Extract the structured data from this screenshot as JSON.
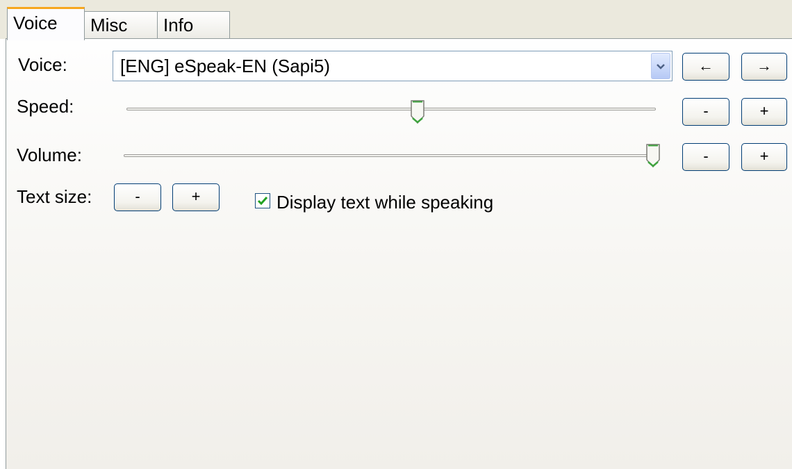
{
  "tabs": [
    {
      "label": "Voice",
      "active": true
    },
    {
      "label": "Misc",
      "active": false
    },
    {
      "label": "Info",
      "active": false
    }
  ],
  "voice": {
    "label": "Voice:",
    "selected": "[ENG] eSpeak-EN (Sapi5)",
    "prev_label": "←",
    "next_label": "→"
  },
  "speed": {
    "label": "Speed:",
    "level_fraction": 0.55,
    "minus": "-",
    "plus": "+"
  },
  "volume": {
    "label": "Volume:",
    "level_fraction": 1.0,
    "minus": "-",
    "plus": "+"
  },
  "text_size": {
    "label": "Text size:",
    "minus": "-",
    "plus": "+"
  },
  "display_text": {
    "label": "Display text while speaking",
    "checked": true
  },
  "colors": {
    "accent_tab": "#f7a71f",
    "check": "#21a121",
    "thumb_green": "#3fa33f",
    "button_border": "#003c74"
  }
}
